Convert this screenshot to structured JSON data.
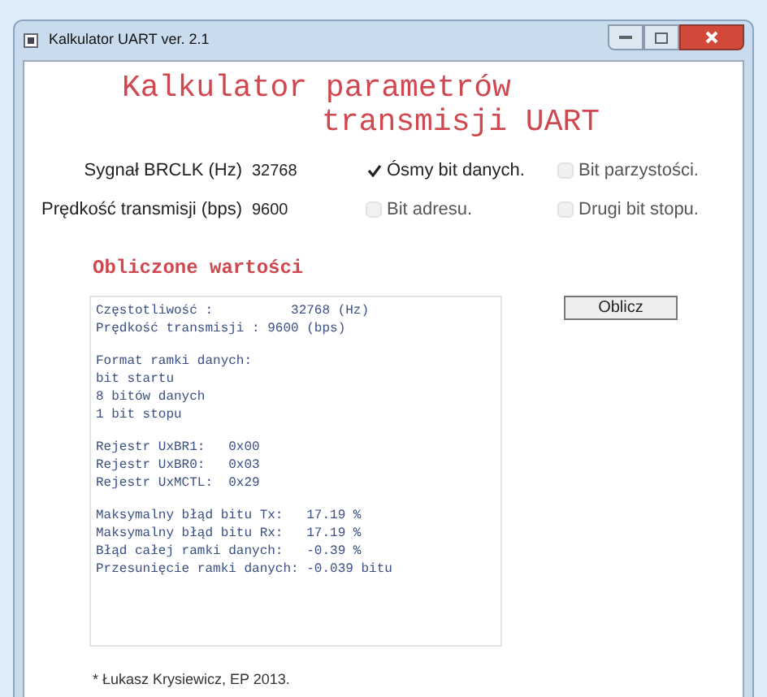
{
  "window": {
    "title": "Kalkulator UART ver. 2.1"
  },
  "heading": [
    "Kalkulator parametrów",
    "transmisji UART"
  ],
  "fields": [
    {
      "label": "Sygnał BRCLK (Hz)",
      "value": "32768"
    },
    {
      "label": "Prędkość transmisji (bps)",
      "value": "9600"
    }
  ],
  "options": [
    {
      "label": "Ósmy bit danych.",
      "checked": true
    },
    {
      "label": "Bit parzystości.",
      "checked": false
    },
    {
      "label": "Bit adresu.",
      "checked": false
    },
    {
      "label": "Drugi bit stopu.",
      "checked": false
    }
  ],
  "results": {
    "title": "Obliczone wartości",
    "blocks": [
      [
        "Częstotliwość :          32768 (Hz)",
        "Prędkość transmisji : 9600 (bps)"
      ],
      [
        "Format ramki danych:",
        "bit startu",
        "8 bitów danych",
        "1 bit stopu"
      ],
      [
        "Rejestr UxBR1:   0x00",
        "Rejestr UxBR0:   0x03",
        "Rejestr UxMCTL:  0x29"
      ],
      [
        "Maksymalny błąd bitu Tx:   17.19 %",
        "Maksymalny błąd bitu Rx:   17.19 %",
        "Błąd całej ramki danych:   -0.39 %",
        "Przesunięcie ramki danych: -0.039 bitu"
      ]
    ]
  },
  "button": "Oblicz",
  "footer": "* Łukasz Krysiewicz, EP 2013."
}
